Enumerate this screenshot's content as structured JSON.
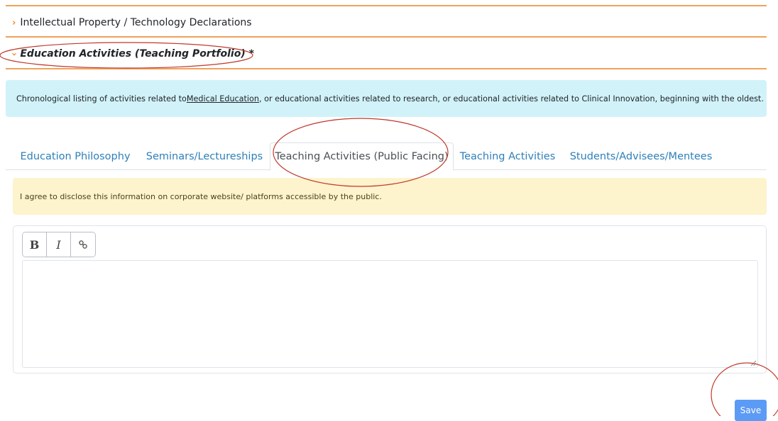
{
  "sections": {
    "ip": {
      "label": "Intellectual Property / Technology Declarations",
      "icon": "chevron-right-icon"
    },
    "education": {
      "label": "Education Activities (Teaching Portfolio) *",
      "icon": "chevron-down-icon"
    }
  },
  "info": {
    "before_link": "Chronological listing of activities related to ",
    "link": "Medical Education",
    "after_link": ", or educational activities related to research, or educational activities related to Clinical Innovation, beginning with the oldest."
  },
  "tabs": [
    {
      "label": "Education Philosophy"
    },
    {
      "label": "Seminars/Lectureships"
    },
    {
      "label": "Teaching Activities (Public Facing)"
    },
    {
      "label": "Teaching Activities"
    },
    {
      "label": "Students/Advisees/Mentees"
    }
  ],
  "active_tab": "Teaching Activities (Public Facing)",
  "disclosure": "I agree to disclose this information on corporate website/ platforms accessible by the public.",
  "toolbar": {
    "bold": "B",
    "italic": "I",
    "link_icon": "link-icon"
  },
  "editor": {
    "value": ""
  },
  "save_label": "Save",
  "colors": {
    "accent_orange": "#f0a25a",
    "tab_link": "#2e7fb8",
    "info_bg": "#d1f2f9",
    "warning_bg": "#fdf3cd",
    "save_button": "#5c9bf5",
    "annotation_red": "#c0392b"
  }
}
